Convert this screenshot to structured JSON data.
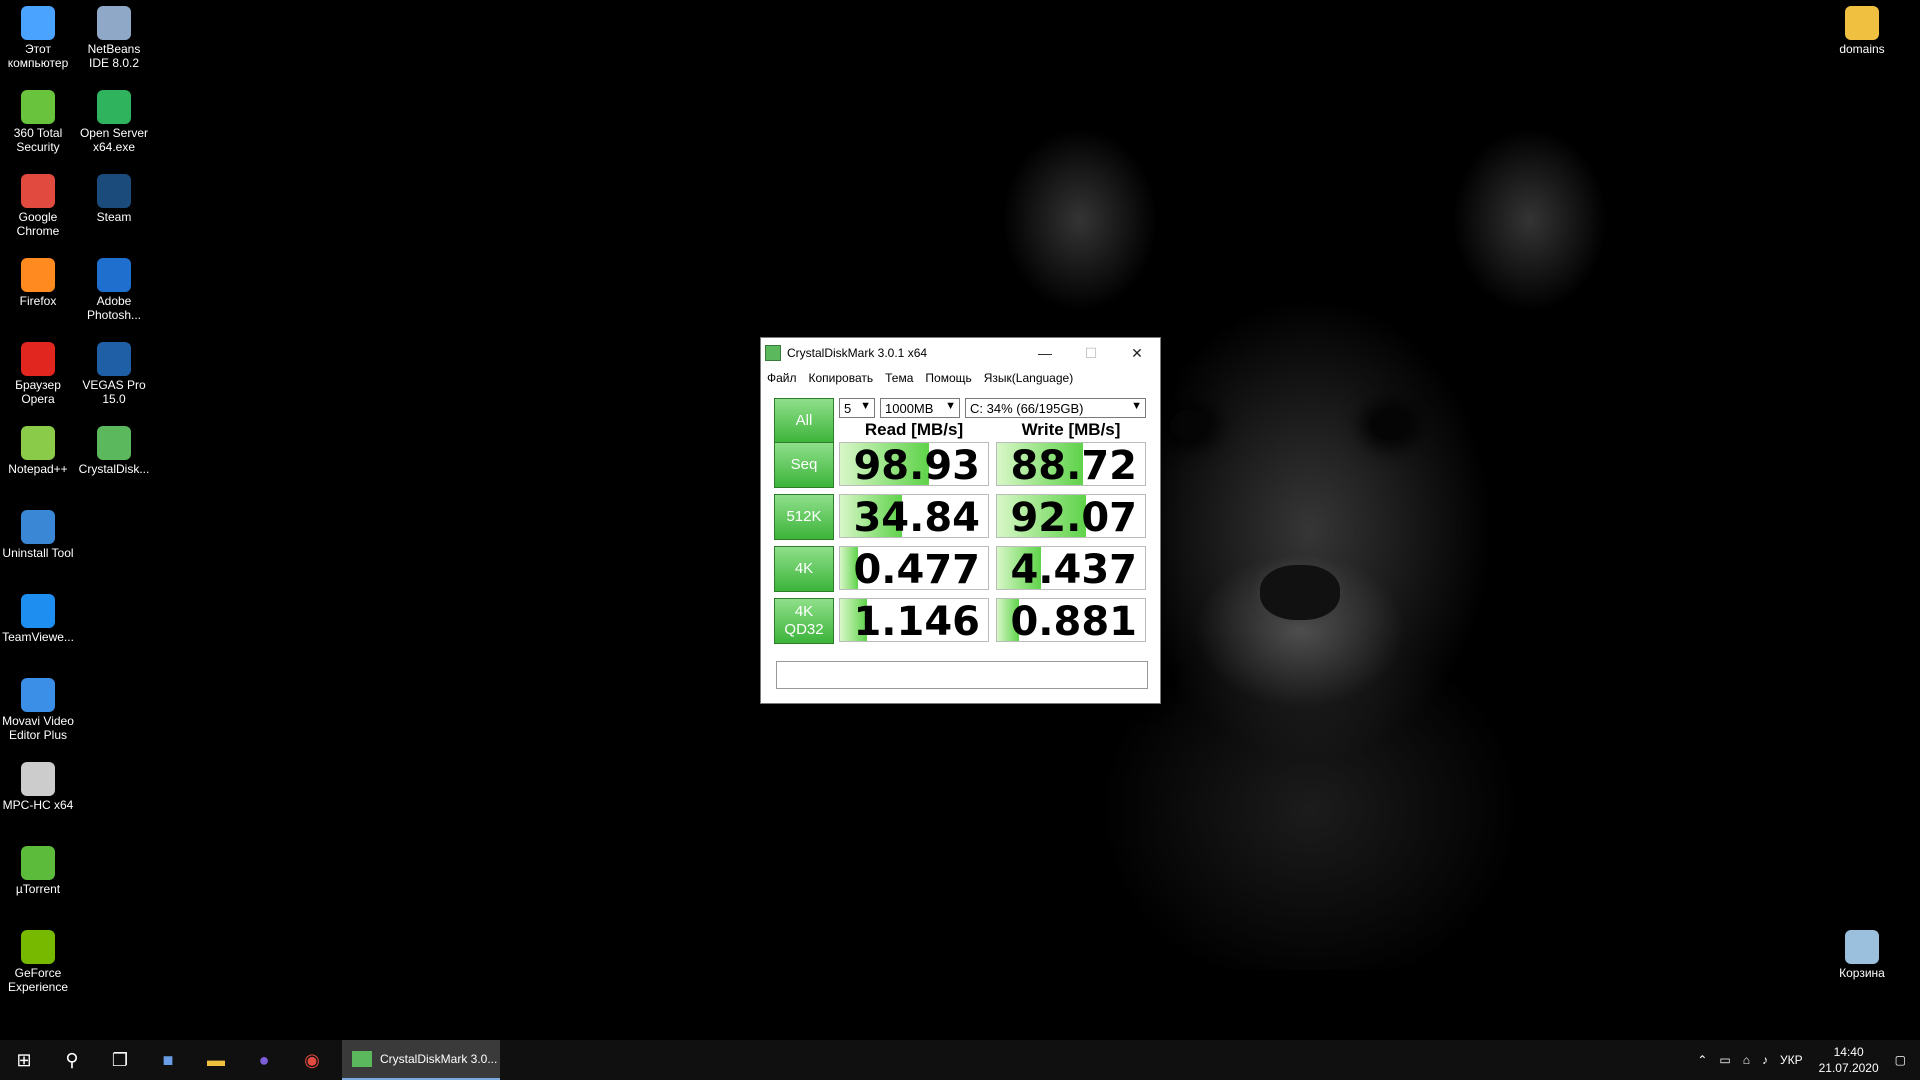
{
  "desktop": {
    "left_icons": [
      {
        "label": "Этот компьютер",
        "icon": "computer-icon",
        "color": "#4aa3ff"
      },
      {
        "label": "NetBeans IDE 8.0.2",
        "icon": "netbeans-icon",
        "color": "#8fa8c8"
      },
      {
        "label": "360 Total Security",
        "icon": "security-icon",
        "color": "#6ac33d"
      },
      {
        "label": "Open Server x64.exe",
        "icon": "open-server-icon",
        "color": "#2fb35c"
      },
      {
        "label": "Google Chrome",
        "icon": "chrome-icon",
        "color": "#e04a3f"
      },
      {
        "label": "Steam",
        "icon": "steam-icon",
        "color": "#1b4b7a"
      },
      {
        "label": "Firefox",
        "icon": "firefox-icon",
        "color": "#ff8a1f"
      },
      {
        "label": "Adobe Photosh...",
        "icon": "photoshop-icon",
        "color": "#1f6fcf"
      },
      {
        "label": "Браузер Opera",
        "icon": "opera-icon",
        "color": "#e0261f"
      },
      {
        "label": "VEGAS Pro 15.0",
        "icon": "vegas-icon",
        "color": "#1f5fa6"
      },
      {
        "label": "Notepad++",
        "icon": "notepad-icon",
        "color": "#8acb4a"
      },
      {
        "label": "CrystalDisk...",
        "icon": "crystaldisk-icon",
        "color": "#5cb85c"
      },
      {
        "label": "Uninstall Tool",
        "icon": "uninstall-icon",
        "color": "#3a87d6"
      },
      {
        "label": "TeamViewe...",
        "icon": "teamviewer-icon",
        "color": "#1e8ef0"
      },
      {
        "label": "Movavi Video Editor Plus",
        "icon": "movavi-icon",
        "color": "#3b8fe6"
      },
      {
        "label": "MPC-HC x64",
        "icon": "mpc-icon",
        "color": "#cccccc"
      },
      {
        "label": "µTorrent",
        "icon": "utorrent-icon",
        "color": "#5dbb3b"
      },
      {
        "label": "GeForce Experience",
        "icon": "geforce-icon",
        "color": "#76b900"
      }
    ],
    "right_icons": [
      {
        "label": "domains",
        "icon": "folder-icon",
        "color": "#f0c040"
      },
      {
        "label": "Корзина",
        "icon": "recycle-bin-icon",
        "color": "#9ac0dd"
      }
    ]
  },
  "window": {
    "title": "CrystalDiskMark 3.0.1 x64",
    "menu": [
      "Файл",
      "Копировать",
      "Тема",
      "Помощь",
      "Язык(Language)"
    ],
    "all_button": "All",
    "count_select": "5",
    "size_select": "1000MB",
    "drive_select": "C: 34% (66/195GB)",
    "read_header": "Read [MB/s]",
    "write_header": "Write [MB/s]",
    "rows": [
      {
        "label": "Seq",
        "read": "98.93",
        "write": "88.72",
        "read_fill": 0.6,
        "write_fill": 0.58
      },
      {
        "label": "512K",
        "read": "34.84",
        "write": "92.07",
        "read_fill": 0.42,
        "write_fill": 0.6
      },
      {
        "label": "4K",
        "read": "0.477",
        "write": "4.437",
        "read_fill": 0.12,
        "write_fill": 0.3
      },
      {
        "label": "4K\nQD32",
        "read": "1.146",
        "write": "0.881",
        "read_fill": 0.18,
        "write_fill": 0.15
      }
    ]
  },
  "taskbar": {
    "active_app": "CrystalDiskMark 3.0...",
    "lang": "УКР",
    "time": "14:40",
    "date": "21.07.2020"
  }
}
